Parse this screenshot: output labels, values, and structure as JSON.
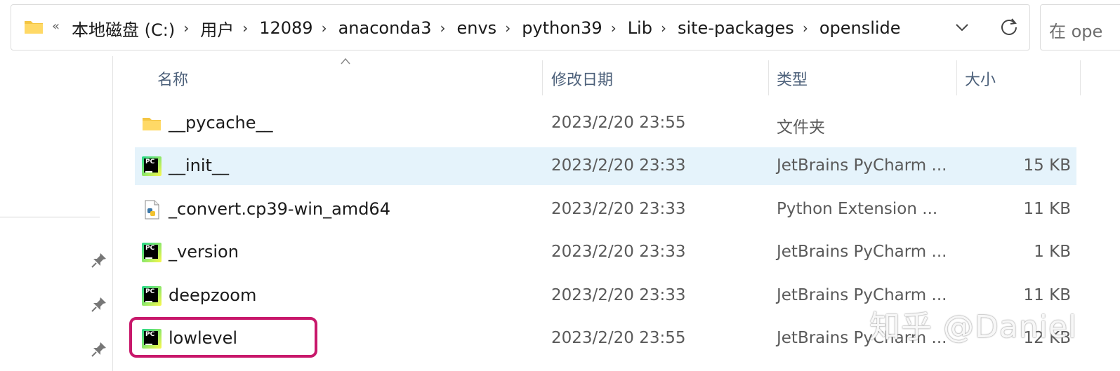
{
  "address_bar": {
    "more_glyph": "«",
    "crumbs": [
      "本地磁盘 (C:)",
      "用户",
      "12089",
      "anaconda3",
      "envs",
      "python39",
      "Lib",
      "site-packages",
      "openslide"
    ]
  },
  "search": {
    "placeholder": "在 ope"
  },
  "columns": {
    "name": "名称",
    "modified": "修改日期",
    "type": "类型",
    "size": "大小"
  },
  "files": [
    {
      "name": "__pycache__",
      "modified": "2023/2/20 23:55",
      "type": "文件夹",
      "size": "",
      "icon": "folder-icon"
    },
    {
      "name": "__init__",
      "modified": "2023/2/20 23:33",
      "type": "JetBrains PyCharm ...",
      "size": "15 KB",
      "icon": "pycharm-file-icon",
      "selected": true
    },
    {
      "name": "_convert.cp39-win_amd64",
      "modified": "2023/2/20 23:33",
      "type": "Python Extension ...",
      "size": "11 KB",
      "icon": "python-extension-icon"
    },
    {
      "name": "_version",
      "modified": "2023/2/20 23:33",
      "type": "JetBrains PyCharm ...",
      "size": "1 KB",
      "icon": "pycharm-file-icon"
    },
    {
      "name": "deepzoom",
      "modified": "2023/2/20 23:33",
      "type": "JetBrains PyCharm ...",
      "size": "11 KB",
      "icon": "pycharm-file-icon"
    },
    {
      "name": "lowlevel",
      "modified": "2023/2/20 23:55",
      "type": "JetBrains PyCharm ...",
      "size": "12 KB",
      "icon": "pycharm-file-icon",
      "highlighted": true
    }
  ],
  "watermark": "知乎 @Daniel",
  "colors": {
    "selected_row": "#e5f3fb",
    "highlight_border": "#c8186b",
    "header_text": "#4c607a"
  }
}
